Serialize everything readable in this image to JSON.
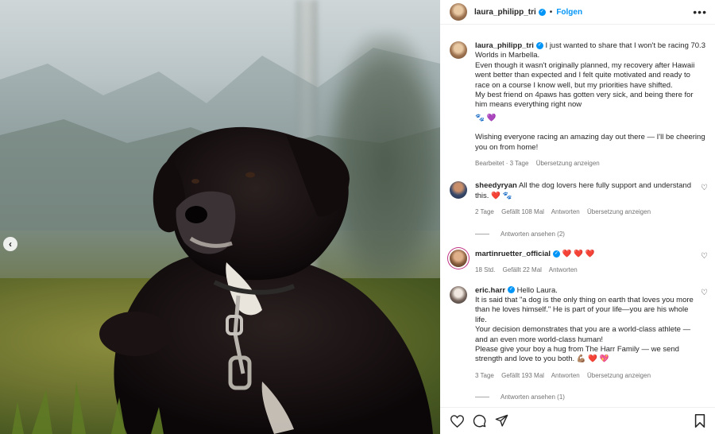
{
  "header": {
    "username": "laura_philipp_tri",
    "separator": "•",
    "follow_label": "Folgen",
    "more_label": "•••"
  },
  "caption": {
    "username": "laura_philipp_tri",
    "text": "I just wanted to share that I won't be racing 70.3 Worlds in Marbella.\nEven though it wasn't originally planned, my recovery after Hawaii went better than expected and I felt quite motivated and ready to race on a course I know well, but my priorities have shifted.\nMy best friend on 4paws has gotten very sick, and being there for him means everything right now",
    "emoji": "🐾 💜",
    "text2": "Wishing everyone racing an amazing day out there — I'll be cheering you on from home!",
    "edited": "Bearbeitet · 3 Tage",
    "translate": "Übersetzung anzeigen"
  },
  "comments": [
    {
      "username": "sheedyryan",
      "text": "All the dog lovers here fully support and understand this. ❤️ 🐾",
      "time": "2 Tage",
      "likes": "Gefällt 108 Mal",
      "reply": "Antworten",
      "translate": "Übersetzung anzeigen",
      "view_replies": "Antworten ansehen (2)"
    },
    {
      "username": "martinruetter_official",
      "text": "❤️ ❤️ ❤️",
      "time": "18 Std.",
      "likes": "Gefällt 22 Mal",
      "reply": "Antworten"
    },
    {
      "username": "eric.harr",
      "text": "Hello Laura.\nIt is said that \"a dog is the only thing on earth that loves you more than he loves himself.\" He is part of your life—you are his whole life.\nYour decision demonstrates that you are a world-class athlete —and an even more world-class human!\nPlease give your boy a hug from The Harr Family — we send strength and love to you both. 💪🏽 ❤️ 💖",
      "time": "3 Tage",
      "likes": "Gefällt 193 Mal",
      "reply": "Antworten",
      "translate": "Übersetzung anzeigen",
      "view_replies": "Antworten ansehen (1)"
    }
  ],
  "carousel": {
    "prev_icon": "‹"
  },
  "icons": {
    "like": "heart-icon",
    "comment": "comment-icon",
    "share": "share-icon",
    "save": "bookmark-icon"
  },
  "colors": {
    "accent": "#0095f6",
    "heart": "#ed4956",
    "muted": "#737373"
  }
}
